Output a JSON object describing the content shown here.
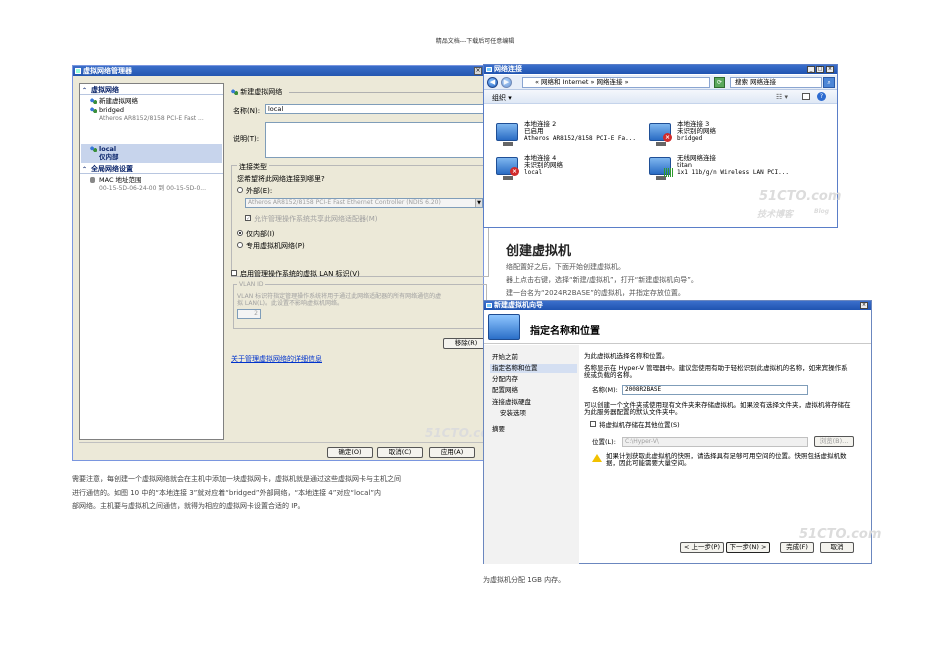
{
  "page_header": "精品文档---下载后可任意编辑",
  "vnm": {
    "title": "虚拟网络管理器",
    "tree": {
      "section_virtual_networks": "虚拟网络",
      "new_network": "新建虚拟网络",
      "bridged_name": "bridged",
      "bridged_adapter": "Atheros AR8152/8158 PCI-E Fast ...",
      "local_name": "local",
      "local_type": "仅内部",
      "section_global": "全局网络设置",
      "mac_range_label": "MAC 地址范围",
      "mac_range_value": "00-15-5D-06-24-00 到 00-15-5D-0..."
    },
    "panel": {
      "header": "新建虚拟网络",
      "name_label": "名称(N):",
      "name_value": "local",
      "desc_label": "说明(T):",
      "conn_type_title": "连接类型",
      "conn_question": "您希望将此网络连接到哪里?",
      "external_label": "外部(E):",
      "adapter_value": "Atheros AR8152/8158 PCI-E Fast Ethernet Controller (NDIS 6.20)",
      "allow_mgmt_label": "允许管理操作系统共享此网络适配器(M)",
      "internal_only_label": "仅内部(I)",
      "private_label": "专用虚拟机网络(P)",
      "vlan_enable_label": "启用管理操作系统的虚拟 LAN 标识(V)",
      "vlan_group_label": "VLAN ID",
      "vlan_desc_1": "VLAN 标识符指定管理操作系统将用于通过此网络适配器的所有网络通信的虚",
      "vlan_desc_2": "拟 LAN(L)。此设置不影响虚拟机网络。",
      "vlan_value": "2",
      "remove_label": "移除(R)",
      "more_info_link": "关于管理虚拟网络的详细信息"
    },
    "buttons": {
      "ok": "确定(O)",
      "cancel": "取消(C)",
      "apply": "应用(A)"
    }
  },
  "nc": {
    "title": "网络连接",
    "breadcrumb": "« 网络和 Internet » 网络连接 »",
    "search_placeholder": "搜索 网络连接",
    "toolbar_organize": "组织 ▾",
    "connections": [
      {
        "name": "本地连接 2",
        "status": "已启用",
        "device": "Atheros AR8152/8158 PCI-E Fa..."
      },
      {
        "name": "本地连接 3",
        "status": "未识别的网络",
        "device": "bridged"
      },
      {
        "name": "本地连接 4",
        "status": "未识别的网络",
        "device": "local"
      },
      {
        "name": "无线网络连接",
        "status": "titan",
        "device": "1x1 11b/g/n Wireless LAN PCI..."
      }
    ],
    "watermark_1": "51CTO.com",
    "watermark_2": "技术博客",
    "watermark_3": "Blog"
  },
  "middle": {
    "section_title": "创建虚拟机",
    "line1": "络配置好之后，下面开始创建虚拟机。",
    "line2": "器上点击右键，选择“新建/虚拟机”，打开“新建虚拟机向导”。",
    "line3": "建一台名为“2024R2BASE”的虚拟机，并指定存放位置。"
  },
  "wizard": {
    "title": "新建虚拟机向导",
    "heading": "指定名称和位置",
    "nav": [
      "开始之前",
      "指定名称和位置",
      "分配内存",
      "配置网络",
      "连接虚拟硬盘",
      "安装选项",
      "摘要"
    ],
    "intro": "为此虚拟机选择名称和位置。",
    "name_hint_1": "名称显示在 Hyper-V 管理器中。建议您使用有助于轻松识别此虚拟机的名称，如来宾操作系",
    "name_hint_2": "统或负载的名称。",
    "name_label": "名称(M):",
    "name_value": "2008R2BASE",
    "folder_hint_1": "可以创建一个文件夹或使用现有文件夹来存储虚拟机。如果没有选择文件夹，虚拟机将存储在",
    "folder_hint_2": "为此服务器配置的默认文件夹中。",
    "store_diff_label": "将虚拟机存储在其他位置(S)",
    "location_label": "位置(L):",
    "location_value": "C:\\Hyper-V\\",
    "browse_label": "浏览(B)...",
    "warn_1": "如果计划获取此虚拟机的快照，请选择具有足够可用空间的位置。快照包括虚拟机数",
    "warn_2": "据，因此可能需要大量空间。",
    "buttons": {
      "prev": "< 上一步(P)",
      "next": "下一步(N) >",
      "finish": "完成(F)",
      "cancel": "取消"
    },
    "watermark": "51CTO.com"
  },
  "bottom_left": {
    "line1": "需要注意，每创建一个虚拟网络就会在主机中添加一块虚拟网卡，虚拟机就是通过这些虚拟网卡与主机之间",
    "line2": "进行通信的。如图 10 中的“本地连接 3”就对应着“bridged”外部网络，“本地连接 4”对应“local”内",
    "line3": "部网络。主机要与虚拟机之间通信，就得为相应的虚拟网卡设置合适的 IP。"
  },
  "bottom_right": {
    "line1": "为虚拟机分配 1GB 内存。"
  },
  "vnm_watermark": "51CTO.com"
}
